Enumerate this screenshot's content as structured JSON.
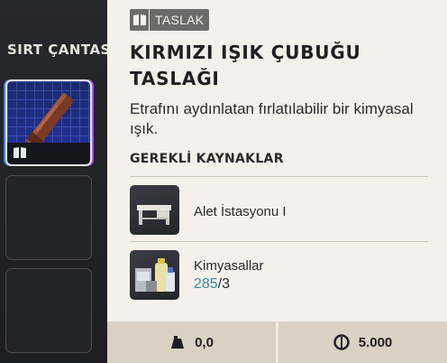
{
  "backpack": {
    "title": "SIRT ÇANTASI"
  },
  "item": {
    "tag_icon": "blueprint-book-icon",
    "tag_label": "TASLAK",
    "title": "KIRMIZI IŞIK ÇUBUĞU TASLAĞI",
    "description": "Etrafını aydınlatan fırlatılabilir bir kimyasal ışık."
  },
  "requirements": {
    "title": "GEREKLİ KAYNAKLAR",
    "items": [
      {
        "name": "Alet İstasyonu I",
        "icon": "workbench-icon"
      },
      {
        "name": "Kimyasallar",
        "icon": "chemicals-icon",
        "have": "285",
        "need": "/3"
      }
    ]
  },
  "footer": {
    "weight": "0,0",
    "weight_icon": "weight-icon",
    "value": "5.000",
    "value_icon": "coin-icon"
  }
}
